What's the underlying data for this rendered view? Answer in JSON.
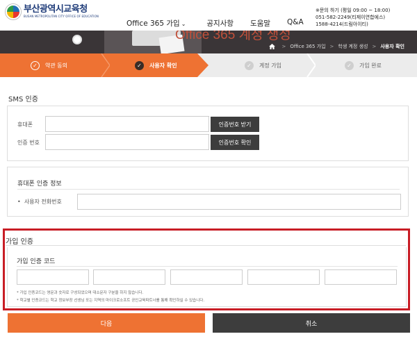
{
  "header": {
    "logo_ko": "부산광역시교육청",
    "logo_en": "BUSAN METROPOLITAN CITY OFFICE OF EDUCATION",
    "nav": [
      "Office 365 가입",
      "공지사항",
      "도움말",
      "Q&A"
    ],
    "contact": [
      "※문의 하기 (평일 09:00 ~ 18:00)",
      "051-582-2249(티제이연합에스)",
      "1588-4214(드림아이티)"
    ]
  },
  "banner": {
    "title": "Office 365 계정 생성",
    "breadcrumb": [
      "Office 365 가입",
      "학생 계정 생성",
      "사용자 확인"
    ]
  },
  "steps": [
    {
      "label": "약관 동의",
      "state": "done"
    },
    {
      "label": "사용자 확인",
      "state": "current"
    },
    {
      "label": "계정 가입",
      "state": "pending"
    },
    {
      "label": "가입 완료",
      "state": "pending"
    }
  ],
  "sms": {
    "title": "SMS 인증",
    "phone_label": "휴대폰",
    "phone_value": "",
    "code_label": "인증 번호",
    "code_value": "",
    "get_code_button": "인증번호 받기",
    "verify_button": "인증번호 확인"
  },
  "phone_info": {
    "title": "휴대폰 인증 정보",
    "user_phone_label": "사용자 전화번호",
    "user_phone_value": ""
  },
  "join": {
    "title": "가입 인증",
    "code_label": "가입 인증 코드",
    "code_fields": [
      "",
      "",
      "",
      "",
      ""
    ],
    "notes": [
      "* 가입 인증코드는 영문과 숫자로 구성되었으며 대소문자 구분을 하지 않습니다.",
      "* 학교별 인증코드는 학교 정보부장 선생님 또는 지역의 마이크로소프트 공인교육파트너를 통해 확인하실 수 있습니다."
    ]
  },
  "buttons": {
    "next": "다음",
    "cancel": "취소"
  },
  "colors": {
    "accent": "#ee7233",
    "dark": "#3d3d3d",
    "highlight": "#c81d25"
  }
}
